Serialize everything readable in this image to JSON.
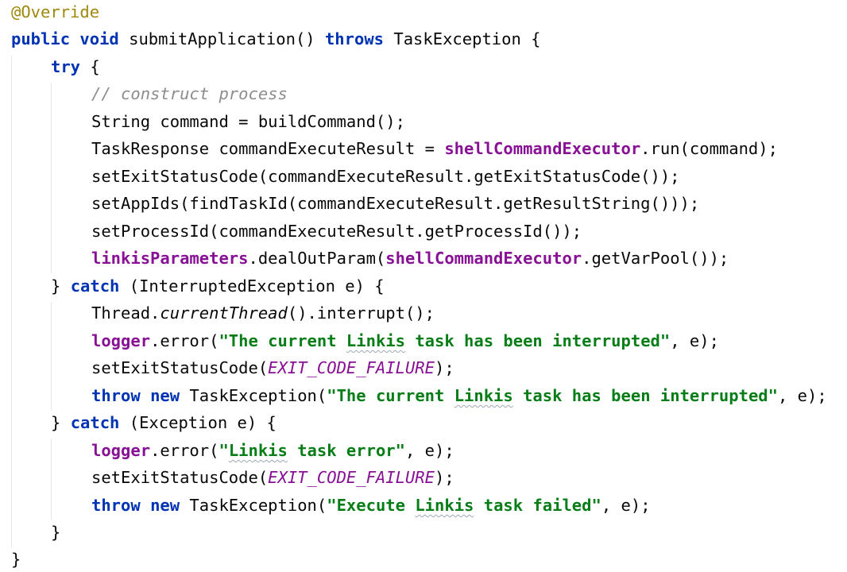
{
  "code": {
    "annotation": "@Override",
    "signature": {
      "public": "public",
      "void": "void",
      "name": " submitApplication() ",
      "throws": "throws",
      "exception_type": " TaskException {"
    },
    "try_kw": "try",
    "try_brace": " {",
    "comment": "// construct process",
    "stmt_build_command": "String command = buildCommand();",
    "stmt_task_response": {
      "prefix": "TaskResponse commandExecuteResult = ",
      "field": "shellCommandExecutor",
      "suffix": ".run(command);"
    },
    "stmt_set_exit_status": "setExitStatusCode(commandExecuteResult.getExitStatusCode());",
    "stmt_set_app_ids": "setAppIds(findTaskId(commandExecuteResult.getResultString()));",
    "stmt_set_process_id": "setProcessId(commandExecuteResult.getProcessId());",
    "stmt_deal_out_param": {
      "field1": "linkisParameters",
      "middle": ".dealOutParam(",
      "field2": "shellCommandExecutor",
      "suffix": ".getVarPool());"
    },
    "catch1": {
      "open": "} ",
      "kw": "catch",
      "rest": " (InterruptedException e) {",
      "interrupt_prefix": "Thread.",
      "interrupt_method": "currentThread",
      "interrupt_suffix": "().interrupt();",
      "logger": "logger",
      "error_call": ".error(",
      "msg_part1": "\"The current ",
      "msg_linkis": "Linkis",
      "msg_part2": " task has been interrupted\"",
      "error_end": ", e);",
      "set_exit_prefix": "setExitStatusCode(",
      "exit_const": "EXIT_CODE_FAILURE",
      "set_exit_suffix": ");",
      "throw_kw": "throw",
      "new_kw": "new",
      "throw_type": " TaskException(",
      "throw_end": ", e);"
    },
    "catch2": {
      "open": "} ",
      "kw": "catch",
      "rest": " (Exception e) {",
      "logger": "logger",
      "error_call": ".error(",
      "msg_open": "\"",
      "msg_linkis": "Linkis",
      "msg_rest": " task error\"",
      "error_end": ", e);",
      "set_exit_prefix": "setExitStatusCode(",
      "exit_const": "EXIT_CODE_FAILURE",
      "set_exit_suffix": ");",
      "throw_kw": "throw",
      "new_kw": "new",
      "throw_type": " TaskException(",
      "throw_msg_open": "\"Execute ",
      "throw_msg_linkis": "Linkis",
      "throw_msg_rest": " task failed\"",
      "throw_end": ", e);"
    },
    "close_try_brace": "}",
    "close_method_brace": "}"
  }
}
